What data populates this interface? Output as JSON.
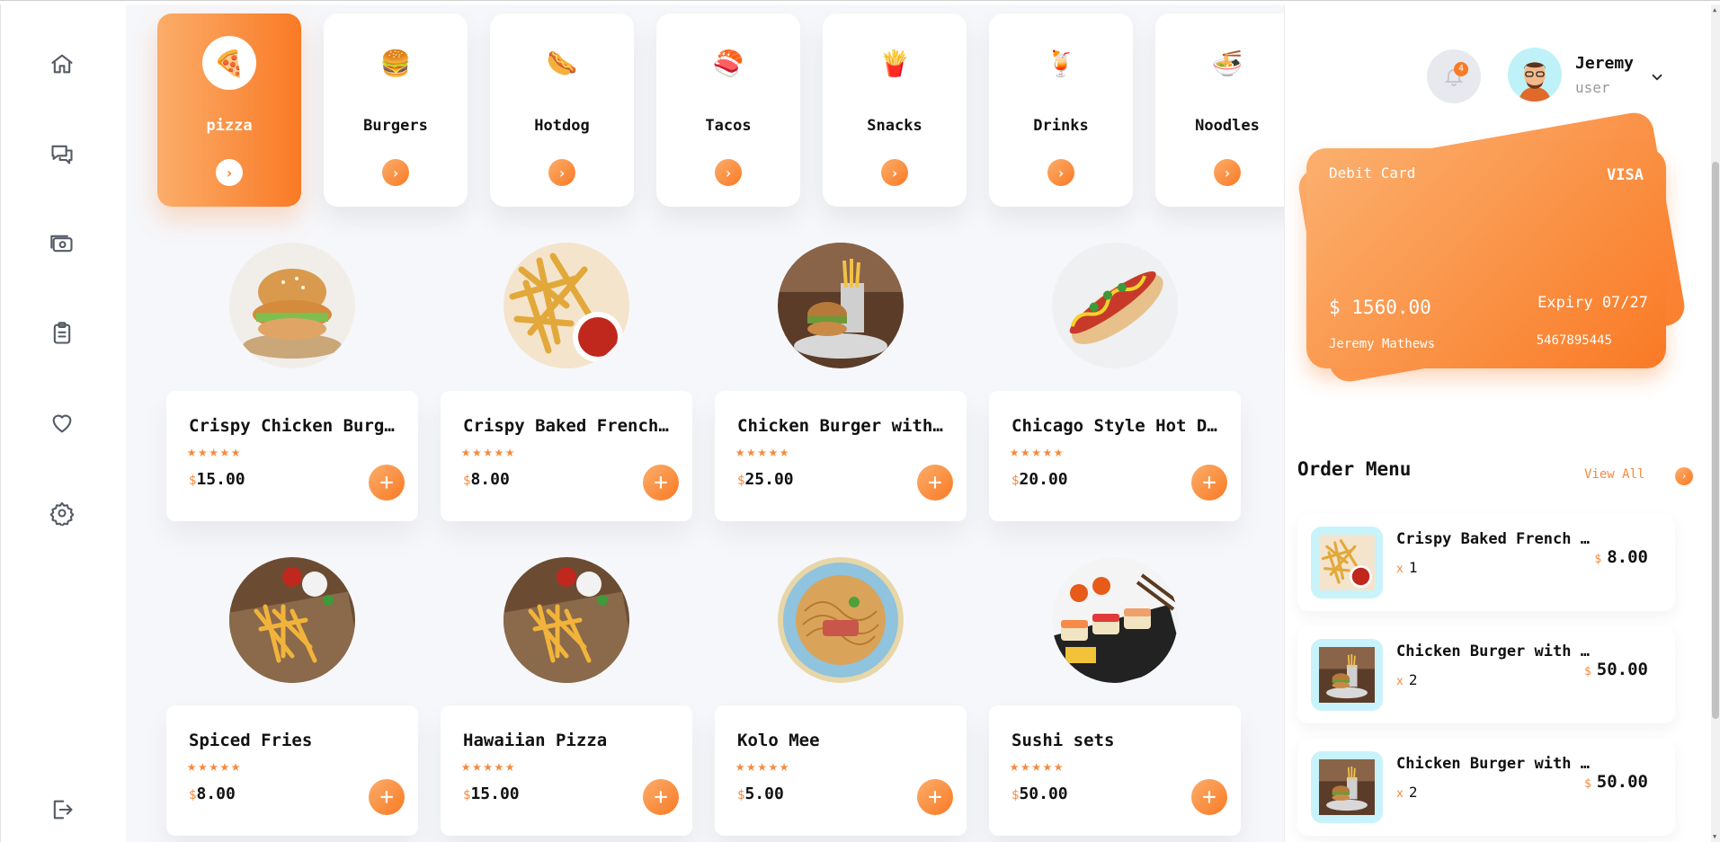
{
  "nav": {
    "items": [
      {
        "icon": "home-icon"
      },
      {
        "icon": "chat-icon"
      },
      {
        "icon": "wallet-icon"
      },
      {
        "icon": "clipboard-icon"
      },
      {
        "icon": "heart-icon"
      },
      {
        "icon": "gear-icon"
      },
      {
        "icon": "logout-icon"
      }
    ]
  },
  "categories": [
    {
      "label": "pizza",
      "emoji": "🍕",
      "active": true,
      "arrow": "›"
    },
    {
      "label": "Burgers",
      "emoji": "🍔",
      "active": false,
      "arrow": "›"
    },
    {
      "label": "Hotdog",
      "emoji": "🌭",
      "active": false,
      "arrow": "›"
    },
    {
      "label": "Tacos",
      "emoji": "🍣",
      "active": false,
      "arrow": "›"
    },
    {
      "label": "Snacks",
      "emoji": "🍟",
      "active": false,
      "arrow": "›"
    },
    {
      "label": "Drinks",
      "emoji": "🍹",
      "active": false,
      "arrow": "›"
    },
    {
      "label": "Noodles",
      "emoji": "🍜",
      "active": false,
      "arrow": "›"
    }
  ],
  "products": [
    {
      "name": "Crispy Chicken Burger",
      "stars": "★★★★★",
      "currency": "$",
      "price": "15.00",
      "add": "+",
      "image": "burger"
    },
    {
      "name": "Crispy Baked French Fries",
      "stars": "★★★★★",
      "currency": "$",
      "price": "8.00",
      "add": "+",
      "image": "fries"
    },
    {
      "name": "Chicken Burger with Home Fries",
      "stars": "★★★★★",
      "currency": "$",
      "price": "25.00",
      "add": "+",
      "image": "burger-fries"
    },
    {
      "name": "Chicago Style Hot Dog",
      "stars": "★★★★★",
      "currency": "$",
      "price": "20.00",
      "add": "+",
      "image": "hotdog"
    },
    {
      "name": "Spiced Fries",
      "stars": "★★★★★",
      "currency": "$",
      "price": "8.00",
      "add": "+",
      "image": "fries-board"
    },
    {
      "name": "Hawaiian Pizza",
      "stars": "★★★★★",
      "currency": "$",
      "price": "15.00",
      "add": "+",
      "image": "fries-board"
    },
    {
      "name": "Kolo Mee",
      "stars": "★★★★★",
      "currency": "$",
      "price": "5.00",
      "add": "+",
      "image": "noodles"
    },
    {
      "name": "Sushi sets",
      "stars": "★★★★★",
      "currency": "$",
      "price": "50.00",
      "add": "+",
      "image": "sushi"
    }
  ],
  "user": {
    "name": "Jeremy",
    "role": "user",
    "notifications": "4"
  },
  "card": {
    "type": "Debit Card",
    "brand": "VISA",
    "amount": "$ 1560.00",
    "expiry": "Expiry 07/27",
    "holder": "Jeremy Mathews",
    "number": "5467895445"
  },
  "order_menu": {
    "title": "Order Menu",
    "view_all": "View All",
    "view_all_arrow": "›",
    "items": [
      {
        "name": "Crispy Baked French Fries",
        "qty_prefix": "x",
        "qty": "1",
        "currency": "$",
        "price": "8.00",
        "image": "fries"
      },
      {
        "name": "Chicken Burger with Home Fries",
        "qty_prefix": "x",
        "qty": "2",
        "currency": "$",
        "price": "50.00",
        "image": "burger-fries"
      },
      {
        "name": "Chicken Burger with Home Fries",
        "qty_prefix": "x",
        "qty": "2",
        "currency": "$",
        "price": "50.00",
        "image": "burger-fries"
      }
    ]
  },
  "colors": {
    "accent": "#fa7a25",
    "accent_light": "#fbad6a",
    "background": "#f6f7fa"
  }
}
